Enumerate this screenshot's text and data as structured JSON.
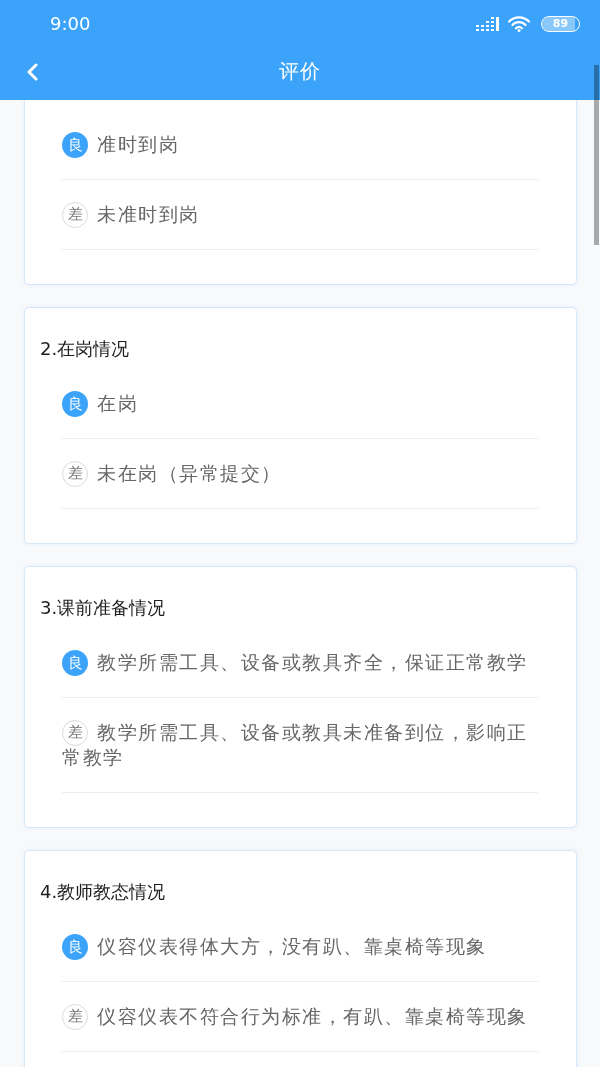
{
  "status_bar": {
    "time": "9:00",
    "battery": "89"
  },
  "header": {
    "title": "评价"
  },
  "sections": [
    {
      "options": [
        {
          "kind": "good",
          "grade": "良",
          "text": "准时到岗"
        },
        {
          "kind": "poor",
          "grade": "差",
          "text": "未准时到岗"
        }
      ]
    },
    {
      "title": "2.在岗情况",
      "options": [
        {
          "kind": "good",
          "grade": "良",
          "text": "在岗"
        },
        {
          "kind": "poor",
          "grade": "差",
          "text": "未在岗（异常提交）"
        }
      ]
    },
    {
      "title": "3.课前准备情况",
      "options": [
        {
          "kind": "good",
          "grade": "良",
          "text": "教学所需工具、设备或教具齐全，保证正常教学"
        },
        {
          "kind": "poor",
          "grade": "差",
          "text": "教学所需工具、设备或教具未准备到位，影响正常教学"
        }
      ]
    },
    {
      "title": "4.教师教态情况",
      "options": [
        {
          "kind": "good",
          "grade": "良",
          "text": "仪容仪表得体大方，没有趴、靠桌椅等现象"
        },
        {
          "kind": "poor",
          "grade": "差",
          "text": "仪容仪表不符合行为标准，有趴、靠桌椅等现象"
        }
      ]
    }
  ]
}
